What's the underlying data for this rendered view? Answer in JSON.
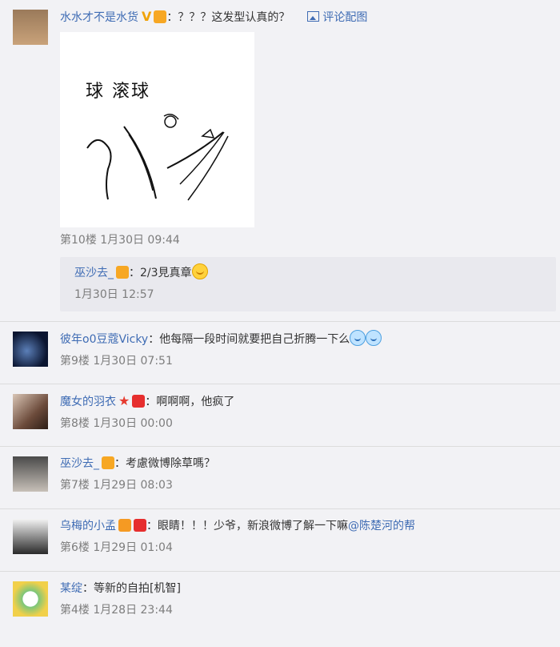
{
  "comments": [
    {
      "user": "水水才不是水货",
      "text": "：？？？这发型认真的？",
      "pic_link": "评论配图",
      "image_text": "球  滚球",
      "meta": "第10楼 1月30日 09:44",
      "reply": {
        "user": "巫沙去_",
        "text": "：2/3見真章",
        "meta": "1月30日 12:57"
      }
    },
    {
      "user": "彼年o0豆蔻Vicky",
      "text": "：他每隔一段时间就要把自己折腾一下么",
      "meta": "第9楼 1月30日 07:51"
    },
    {
      "user": "魔女的羽衣",
      "text": "：啊啊啊，他疯了",
      "meta": "第8楼 1月30日 00:00"
    },
    {
      "user": "巫沙去_",
      "text": "：考慮微博除草嗎？",
      "meta": "第7楼 1月29日 08:03"
    },
    {
      "user": "乌梅的小孟",
      "text": "：眼睛！！！少爷，新浪微博了解一下嘛",
      "mention": "@陈楚河的帮",
      "meta": "第6楼 1月29日 01:04"
    },
    {
      "user": "某绽",
      "text": "：等新的自拍[机智]",
      "meta": "第4楼 1月28日 23:44"
    }
  ],
  "colors": {
    "link": "#3f6cb4",
    "meta": "#7d7d7d",
    "background": "#f2f2f5"
  }
}
